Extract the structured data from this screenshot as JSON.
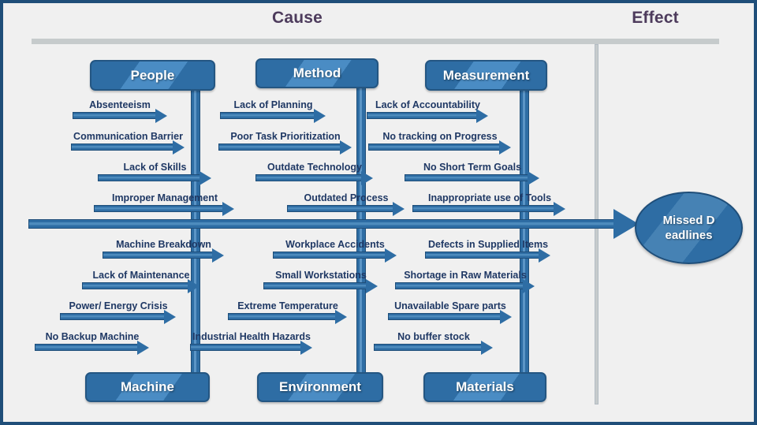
{
  "header": {
    "cause_label": "Cause",
    "effect_label": "Effect"
  },
  "effect": {
    "label": "Missed Deadlines"
  },
  "colors": {
    "accent": "#2e6da4",
    "accent_light": "#4a8cc4",
    "border": "#1f4e79",
    "background": "#f0f0f0",
    "title_text": "#4d3b5c",
    "cause_text": "#1f3864",
    "divider_grey": "#c6cbcc"
  },
  "categories": [
    {
      "name": "People",
      "position": "top",
      "causes": [
        "Absenteeism",
        "Communication Barrier",
        "Lack of  Skills",
        "Improper Management"
      ]
    },
    {
      "name": "Method",
      "position": "top",
      "causes": [
        "Lack of Planning",
        "Poor Task Prioritization",
        "Outdate Technology",
        "Outdated Process"
      ]
    },
    {
      "name": "Measurement",
      "position": "top",
      "causes": [
        "Lack of Accountability",
        "No tracking on Progress",
        "No Short Term Goals",
        "Inappropriate use of Tools"
      ]
    },
    {
      "name": "Machine",
      "position": "bottom",
      "causes": [
        "Machine Breakdown",
        "Lack of Maintenance",
        "Power/ Energy Crisis",
        "No Backup Machine"
      ]
    },
    {
      "name": "Environment",
      "position": "bottom",
      "causes": [
        "Workplace Accidents",
        "Small Workstations",
        "Extreme Temperature",
        "Industrial Health Hazards"
      ]
    },
    {
      "name": "Materials",
      "position": "bottom",
      "causes": [
        "Defects in Supplied Items",
        "Shortage in Raw Materials",
        "Unavailable Spare parts",
        "No buffer stock"
      ]
    }
  ]
}
